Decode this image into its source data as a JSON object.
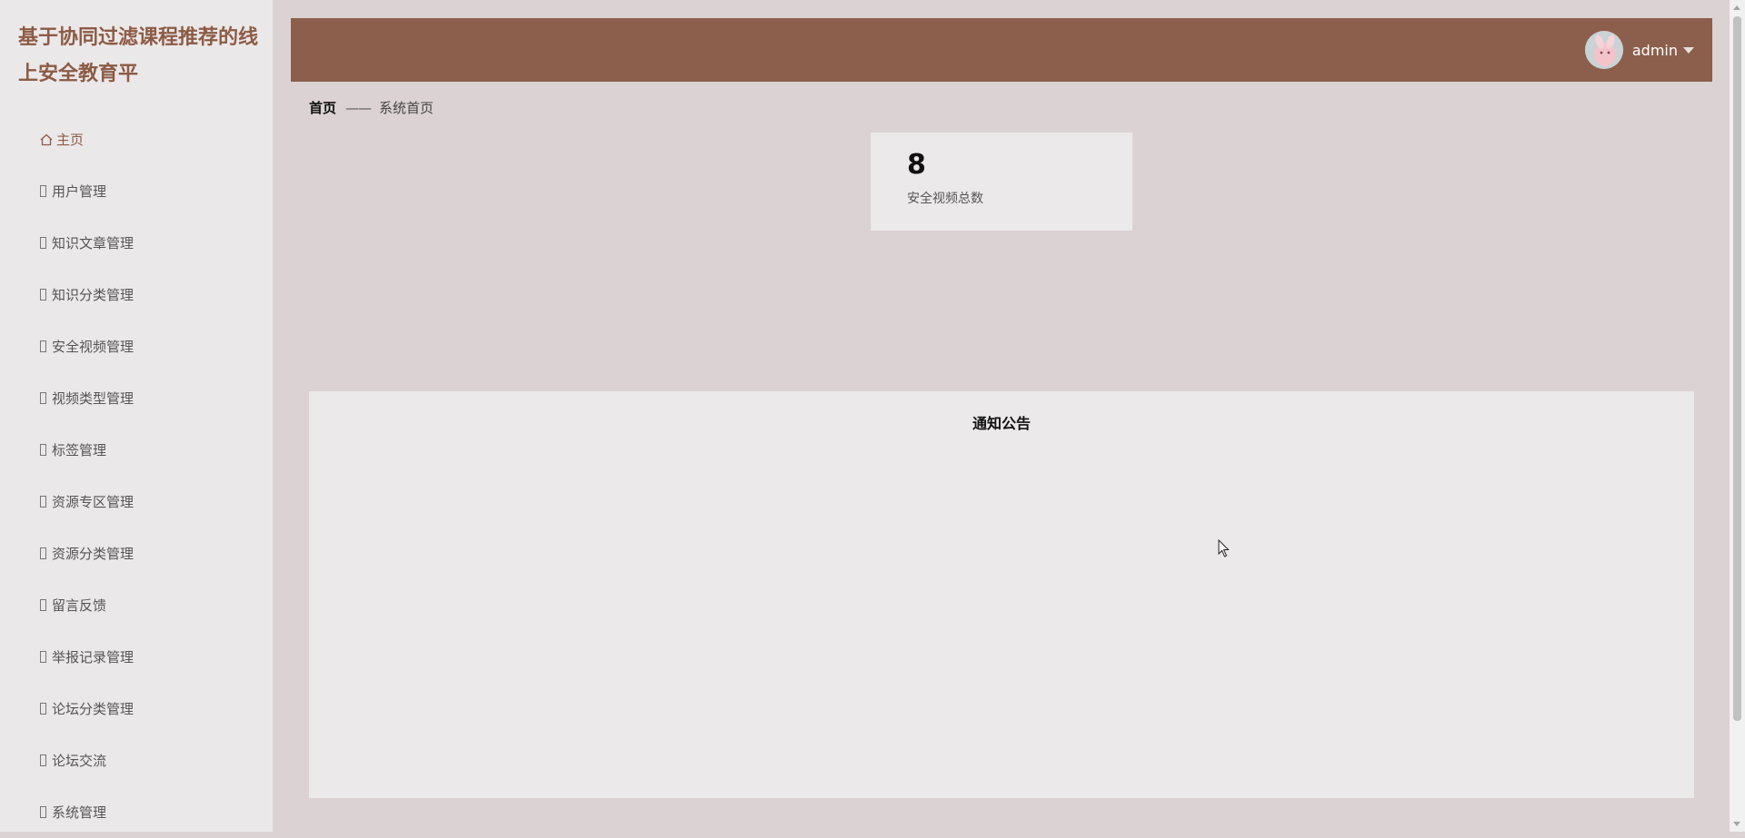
{
  "app_title": "基于协同过滤课程推荐的线上安全教育平",
  "sidebar": {
    "items": [
      {
        "label": "主页",
        "icon": "home-icon"
      },
      {
        "label": "用户管理",
        "icon": "missing-glyph-icon"
      },
      {
        "label": "知识文章管理",
        "icon": "missing-glyph-icon"
      },
      {
        "label": "知识分类管理",
        "icon": "missing-glyph-icon"
      },
      {
        "label": "安全视频管理",
        "icon": "missing-glyph-icon"
      },
      {
        "label": "视频类型管理",
        "icon": "missing-glyph-icon"
      },
      {
        "label": "标签管理",
        "icon": "missing-glyph-icon"
      },
      {
        "label": "资源专区管理",
        "icon": "missing-glyph-icon"
      },
      {
        "label": "资源分类管理",
        "icon": "missing-glyph-icon"
      },
      {
        "label": "留言反馈",
        "icon": "missing-glyph-icon"
      },
      {
        "label": "举报记录管理",
        "icon": "missing-glyph-icon"
      },
      {
        "label": "论坛分类管理",
        "icon": "missing-glyph-icon"
      },
      {
        "label": "论坛交流",
        "icon": "missing-glyph-icon"
      },
      {
        "label": "系统管理",
        "icon": "missing-glyph-icon"
      }
    ]
  },
  "header": {
    "user_name": "admin"
  },
  "breadcrumb": {
    "home": "首页",
    "separator": "——",
    "current": "系统首页"
  },
  "stats": {
    "video_total_value": "8",
    "video_total_label": "安全视频总数"
  },
  "notice": {
    "title": "通知公告"
  },
  "colors": {
    "accent": "#8c5f4c",
    "title": "#8c5b45",
    "background": "#dbd2d4",
    "sidebar_bg": "#ebe8e9",
    "card_bg": "#ebe9e9"
  }
}
